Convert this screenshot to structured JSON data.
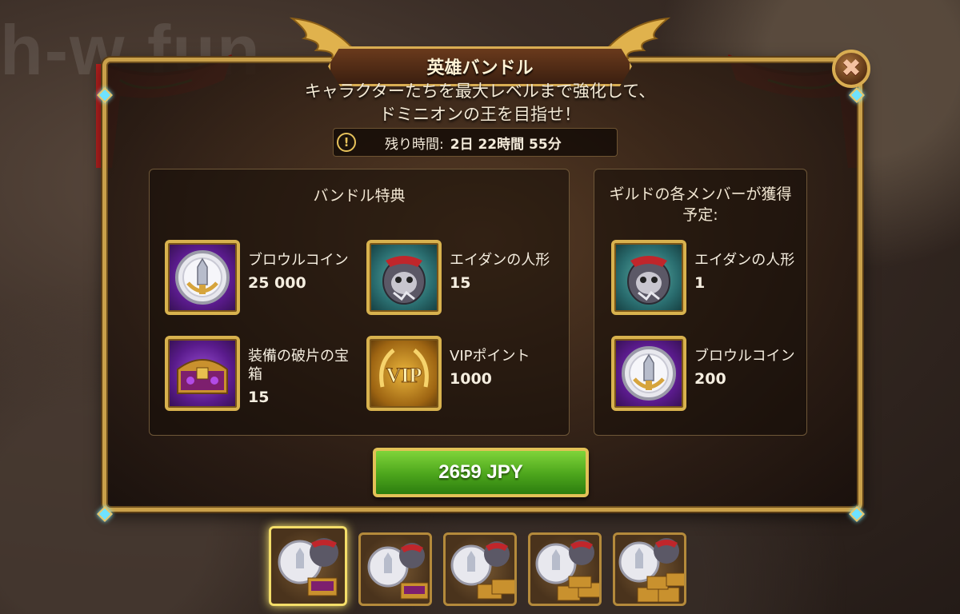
{
  "watermark": "h-w fun",
  "dialog": {
    "title": "英雄バンドル",
    "subtitle_line1": "キャラクターたちを最大レベルまで強化して、",
    "subtitle_line2": "ドミニオンの王を目指せ！",
    "timer_icon": "!",
    "timer_label": "残り時間:",
    "timer_value": "2日 22時間 55分",
    "close_icon": "✖"
  },
  "bundle": {
    "title": "バンドル特典",
    "items": [
      {
        "name": "ブロウルコイン",
        "qty": "25 000",
        "icon": "brawl-coin-icon"
      },
      {
        "name": "エイダンの人形",
        "qty": "15",
        "icon": "aidan-doll-icon"
      },
      {
        "name": "装備の破片の宝箱",
        "qty": "15",
        "icon": "gear-shard-chest-icon"
      },
      {
        "name": "VIPポイント",
        "qty": "1000",
        "icon": "vip-points-icon"
      }
    ]
  },
  "guild": {
    "title": "ギルドの各メンバーが獲得予定:",
    "items": [
      {
        "name": "エイダンの人形",
        "qty": "1",
        "icon": "aidan-doll-icon"
      },
      {
        "name": "ブロウルコイン",
        "qty": "200",
        "icon": "brawl-coin-icon"
      }
    ]
  },
  "buy": {
    "label": "2659 JPY"
  },
  "colors": {
    "gold": "#d8b24e",
    "green": "#4ca51c",
    "purple": "#5a1b8c",
    "teal": "#2a6d6f"
  },
  "tabs": {
    "count": 5,
    "selected_index": 0
  }
}
